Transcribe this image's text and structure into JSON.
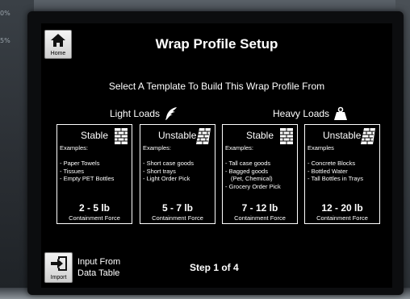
{
  "background": {
    "percent_top": "0%",
    "percent_mid": "5%"
  },
  "header": {
    "title": "Wrap Profile Setup",
    "home_label": "Home",
    "home_icon": "home-icon"
  },
  "prompt": "Select A Template To Build This Wrap Profile From",
  "categories": {
    "light": {
      "label": "Light Loads",
      "icon": "feather-icon"
    },
    "heavy": {
      "label": "Heavy Loads",
      "icon": "weight-icon"
    }
  },
  "cards": [
    {
      "title": "Stable",
      "icon": "stable-pallet-icon",
      "examples_label": "Examples:",
      "items": [
        "- Paper Towels",
        "- Tissues",
        "- Empty PET Bottles"
      ],
      "force": "2 - 5 lb",
      "force_label": "Containment Force"
    },
    {
      "title": "Unstable",
      "icon": "unstable-pallet-icon",
      "examples_label": "Examples:",
      "items": [
        "- Short case goods",
        "- Short trays",
        "- Light Order Pick"
      ],
      "force": "5 - 7 lb",
      "force_label": "Containment Force"
    },
    {
      "title": "Stable",
      "icon": "stable-pallet-icon",
      "examples_label": "Examples:",
      "items": [
        "- Tall case goods",
        "- Bagged goods",
        "   (Pet, Chemical)",
        "- Grocery Order Pick"
      ],
      "force": "7 - 12 lb",
      "force_label": "Containment Force"
    },
    {
      "title": "Unstable",
      "icon": "unstable-pallet-icon",
      "examples_label": "Examples",
      "items": [
        "- Concrete Blocks",
        "- Bottled Water",
        "- Tall Bottles in Trays"
      ],
      "force": "12 - 20 lb",
      "force_label": "Containment Force"
    }
  ],
  "footer": {
    "import_label": "Import",
    "import_icon": "import-icon",
    "import_text_line1": "Input From",
    "import_text_line2": "Data Table",
    "step": "Step 1 of 4"
  }
}
